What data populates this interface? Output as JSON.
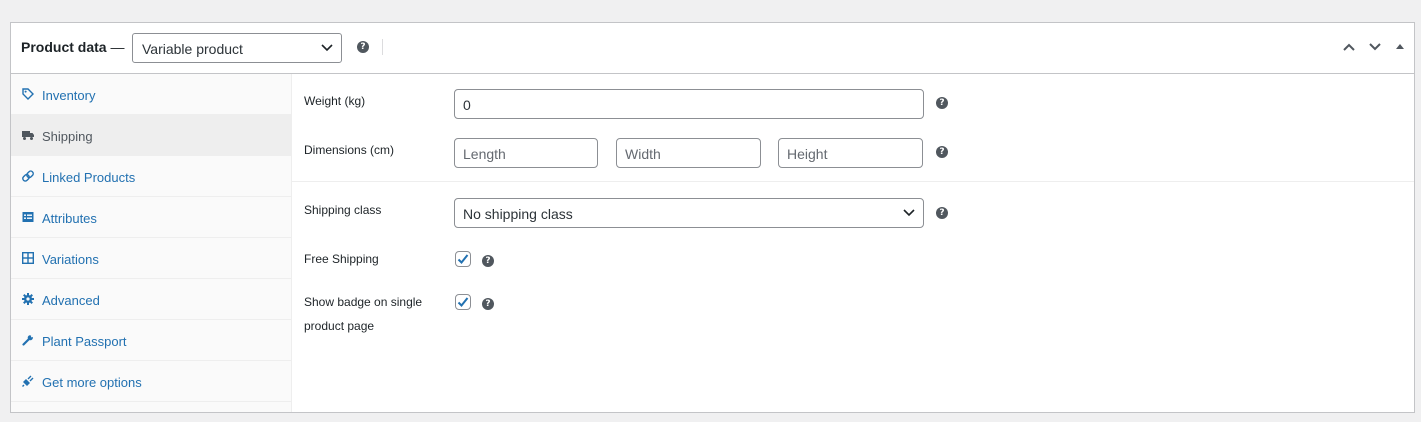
{
  "header": {
    "title": "Product data",
    "dash": "—",
    "product_type": "Variable product",
    "help": "?"
  },
  "sidebar": {
    "items": [
      {
        "label": "Inventory",
        "icon": "tag-icon",
        "active": false
      },
      {
        "label": "Shipping",
        "icon": "truck-icon",
        "active": true
      },
      {
        "label": "Linked Products",
        "icon": "link-icon",
        "active": false
      },
      {
        "label": "Attributes",
        "icon": "list-icon",
        "active": false
      },
      {
        "label": "Variations",
        "icon": "grid-icon",
        "active": false
      },
      {
        "label": "Advanced",
        "icon": "gear-icon",
        "active": false
      },
      {
        "label": "Plant Passport",
        "icon": "wrench-icon",
        "active": false
      },
      {
        "label": "Get more options",
        "icon": "plugin-icon",
        "active": false
      }
    ]
  },
  "shipping": {
    "weight_label": "Weight (kg)",
    "weight_value": "0",
    "dimensions_label": "Dimensions (cm)",
    "length_placeholder": "Length",
    "width_placeholder": "Width",
    "height_placeholder": "Height",
    "class_label": "Shipping class",
    "class_value": "No shipping class",
    "free_label": "Free Shipping",
    "free_checked": true,
    "badge_label_line1": "Show badge on single",
    "badge_label_line2": "product page",
    "badge_checked": true,
    "help": "?"
  },
  "colors": {
    "link": "#2271b1",
    "active_text": "#50575e",
    "border": "#c3c4c7"
  }
}
